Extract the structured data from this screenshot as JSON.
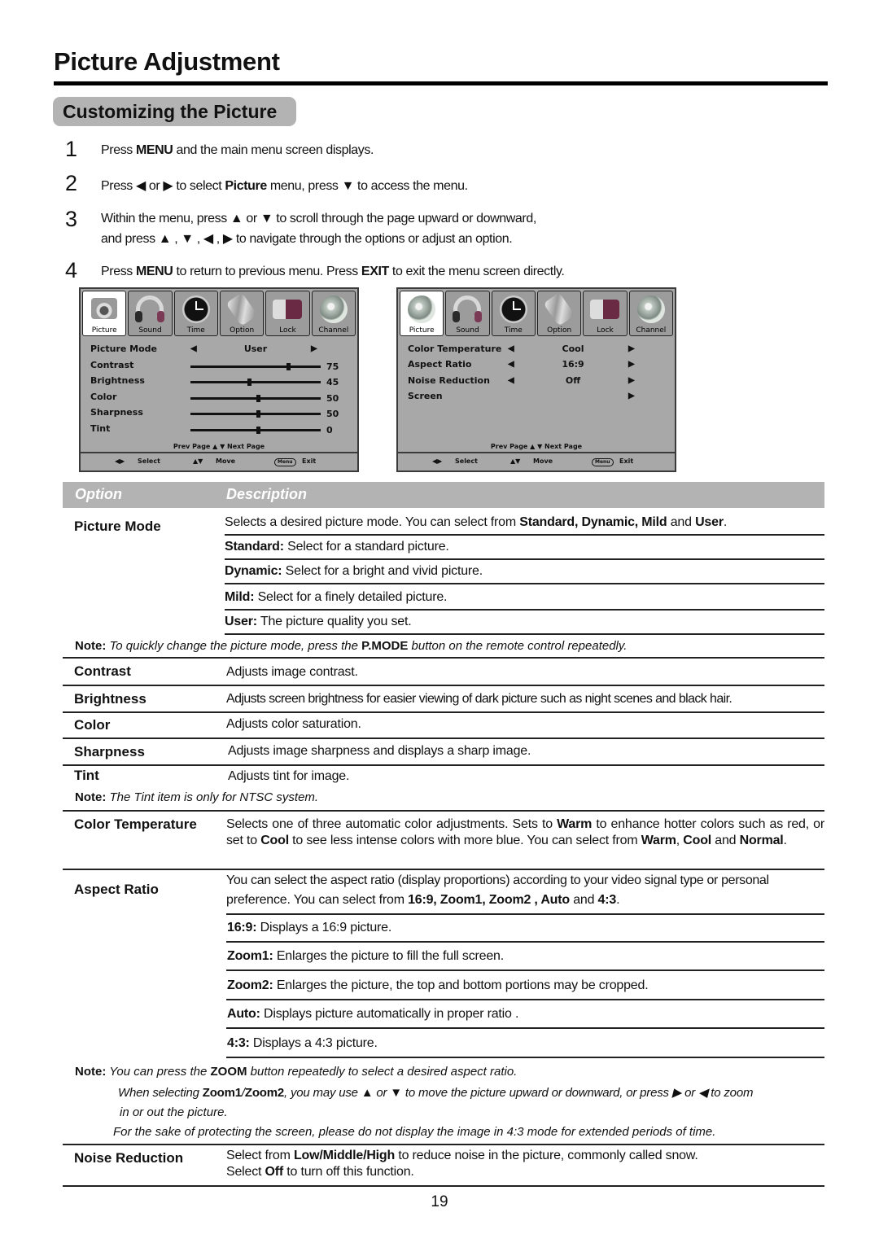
{
  "header": {
    "title": "Picture Adjustment",
    "section": "Customizing the Picture"
  },
  "steps": [
    {
      "num": "1",
      "parts": [
        [
          "Press ",
          false
        ],
        [
          "MENU",
          true
        ],
        [
          " and the main menu screen displays.",
          false
        ]
      ]
    },
    {
      "num": "2",
      "parts": [
        [
          "Press ",
          false
        ],
        [
          "◀",
          false
        ],
        [
          " or ",
          false
        ],
        [
          "▶",
          false
        ],
        [
          " to select ",
          false
        ],
        [
          "Picture",
          true
        ],
        [
          " menu,  press ",
          false
        ],
        [
          "▼",
          false
        ],
        [
          " to access the menu.",
          false
        ]
      ]
    },
    {
      "num": "3",
      "line1": "Within the menu, press ▲ or ▼ to scroll through the page upward or downward,",
      "line2": "and press ▲ , ▼ , ◀ , ▶ to navigate through the options or adjust an option."
    },
    {
      "num": "4",
      "parts": [
        [
          "Press ",
          false
        ],
        [
          "MENU",
          true
        ],
        [
          " to return to previous menu. Press ",
          false
        ],
        [
          "EXIT",
          true
        ],
        [
          " to exit the menu screen directly.",
          false
        ]
      ]
    }
  ],
  "osd_tabs": [
    {
      "label": "Picture",
      "icon": "camera-icon"
    },
    {
      "label": "Sound",
      "icon": "headphones-icon"
    },
    {
      "label": "Time",
      "icon": "clock-icon"
    },
    {
      "label": "Option",
      "icon": "tools-icon"
    },
    {
      "label": "Lock",
      "icon": "lock-icon"
    },
    {
      "label": "Channel",
      "icon": "globe-icon"
    }
  ],
  "osd1": {
    "picture_mode": {
      "label": "Picture Mode",
      "value": "User"
    },
    "sliders": [
      {
        "label": "Contrast",
        "value": 75,
        "position": 0.75
      },
      {
        "label": "Brightness",
        "value": 45,
        "position": 0.45
      },
      {
        "label": "Color",
        "value": 50,
        "position": 0.52
      },
      {
        "label": "Sharpness",
        "value": 50,
        "position": 0.52
      },
      {
        "label": "Tint",
        "value": 0,
        "position": 0.52
      }
    ]
  },
  "osd2": {
    "rows": [
      {
        "label": "Color Temperature",
        "value": "Cool",
        "has_left": true
      },
      {
        "label": "Aspect Ratio",
        "value": "16:9",
        "has_left": true
      },
      {
        "label": "Noise Reduction",
        "value": "Off",
        "has_left": true
      },
      {
        "label": "Screen",
        "value": "",
        "has_left": false
      }
    ]
  },
  "osd_common": {
    "page_nav": "Prev  Page ▲  ▼ Next  Page",
    "footer_select": "Select",
    "footer_move": "Move",
    "footer_menu_btn": "Menu",
    "footer_exit": "Exit"
  },
  "table": {
    "head_option": "Option",
    "head_description": "Description",
    "picture_mode": {
      "label": "Picture Mode",
      "intro": [
        [
          "Selects a desired picture mode. You can select from ",
          false
        ],
        [
          "Standard, Dynamic, Mild",
          true
        ],
        [
          " and ",
          false
        ],
        [
          "User",
          true
        ],
        [
          ".",
          false
        ]
      ],
      "modes": [
        {
          "name": "Standard:",
          "text": " Select for a standard picture."
        },
        {
          "name": "Dynamic:",
          "text": " Select for a bright and vivid picture."
        },
        {
          "name": "Mild:",
          "text": " Select for a finely detailed picture."
        },
        {
          "name": "User:",
          "text": " The picture quality you set."
        }
      ],
      "note_label": "Note:",
      "note": [
        [
          " To quickly change the picture mode, press the ",
          false
        ],
        [
          "P.MODE",
          true
        ],
        [
          " button on the remote control repeatedly.",
          false
        ]
      ]
    },
    "simple_rows": [
      {
        "label": "Contrast",
        "text": "Adjusts image contrast."
      },
      {
        "label": "Brightness",
        "text": "Adjusts screen brightness for easier viewing of dark picture such as night scenes and black hair."
      },
      {
        "label": "Color",
        "text": "Adjusts color saturation."
      },
      {
        "label": "Sharpness",
        "text": "Adjusts image sharpness and displays a sharp image."
      },
      {
        "label": "Tint",
        "text": "Adjusts tint for image."
      }
    ],
    "tint_note_label": "Note:",
    "tint_note": " The Tint item is only for NTSC system.",
    "color_temperature": {
      "label": "Color Temperature",
      "text": [
        [
          "Selects one of three automatic color adjustments.  Sets to ",
          false
        ],
        [
          "Warm",
          true
        ],
        [
          " to enhance hotter colors such as red,  or set to ",
          false
        ],
        [
          "Cool",
          true
        ],
        [
          " to see less intense colors with more blue.  You can select from ",
          false
        ],
        [
          "Warm",
          true
        ],
        [
          ", ",
          false
        ],
        [
          "Cool",
          true
        ],
        [
          " and ",
          false
        ],
        [
          "Normal",
          true
        ],
        [
          ".",
          false
        ]
      ]
    },
    "aspect_ratio": {
      "label": "Aspect Ratio",
      "line1": "You can select the aspect ratio (display proportions) according to your video signal type or personal",
      "line2": [
        [
          "preference. You can select from ",
          false
        ],
        [
          "16:9,  Zoom1, Zoom2 , Auto",
          true
        ],
        [
          " and ",
          false
        ],
        [
          "4:3",
          true
        ],
        [
          ".",
          false
        ]
      ],
      "modes": [
        {
          "name": "16:9:",
          "text": " Displays a 16:9 picture."
        },
        {
          "name": "Zoom1:",
          "text": " Enlarges the picture to fill the full screen."
        },
        {
          "name": "Zoom2:",
          "text": " Enlarges the picture, the top and bottom portions may be cropped."
        },
        {
          "name": "Auto:",
          "text": " Displays picture automatically in proper ratio ."
        },
        {
          "name": "4:3:",
          "text": " Displays a 4:3 picture."
        }
      ],
      "note_label": "Note:",
      "note1": [
        [
          " You can press the ",
          false
        ],
        [
          "ZOOM",
          true
        ],
        [
          " button repeatedly to select a desired aspect ratio.",
          false
        ]
      ],
      "note2": [
        [
          "When selecting ",
          false
        ],
        [
          "Zoom1",
          true
        ],
        [
          "/",
          false
        ],
        [
          "Zoom2",
          true
        ],
        [
          ", you may use ▲ or ▼ to move the picture upward or downward, or press ▶ or ◀ to zoom",
          false
        ]
      ],
      "note3": "in or out the picture.",
      "note4": "For the sake of protecting the screen, please do not display the image in 4:3 mode for extended periods of time."
    },
    "noise_reduction": {
      "label": "Noise Reduction",
      "line1": [
        [
          "Select from ",
          false
        ],
        [
          "Low/Middle/High",
          true
        ],
        [
          " to reduce noise in the picture, commonly called snow.",
          false
        ]
      ],
      "line2": [
        [
          "Select ",
          false
        ],
        [
          "Off",
          true
        ],
        [
          " to turn off this function.",
          false
        ]
      ]
    }
  },
  "page_number": "19"
}
